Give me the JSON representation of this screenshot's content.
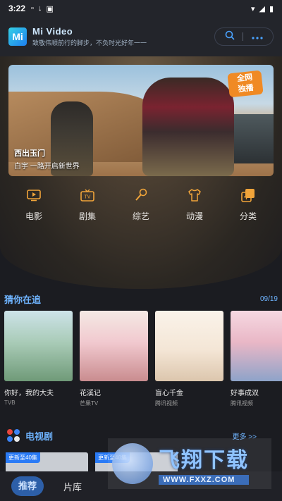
{
  "status_bar": {
    "time": "3:22"
  },
  "header": {
    "logo_text": "Mi",
    "app_name": "Mi Video",
    "slogan": "致敬伟顺前行的脚步，不负时光好年一一"
  },
  "banner": {
    "badge": "全网\n独播",
    "title": "西出玉门",
    "subtitle": "白宇&nbsp;一路开启新世界"
  },
  "categories": [
    {
      "label": "电影",
      "icon": "tv-icon"
    },
    {
      "label": "剧集",
      "icon": "tv-set-icon"
    },
    {
      "label": "综艺",
      "icon": "microphone-icon"
    },
    {
      "label": "动漫",
      "icon": "tshirt-icon"
    },
    {
      "label": "分类",
      "icon": "layers-icon"
    }
  ],
  "section1": {
    "title": "猜你在追",
    "date": "09/19"
  },
  "posters": [
    {
      "title": "你好，我的大夫",
      "source": "TVB",
      "color_a": "#a9cbb7",
      "color_b": "#d8dcc8"
    },
    {
      "title": "花溪记",
      "source": "芒果TV",
      "color_a": "#f1c9cf",
      "color_b": "#e7dbd3"
    },
    {
      "title": "盲心千金",
      "source": "腾讯视频",
      "color_a": "#f4e6d6",
      "color_b": "#efe2cf"
    },
    {
      "title": "好事成双",
      "source": "腾讯视频",
      "color_a": "#e9b7c6",
      "color_b": "#b9c6de"
    }
  ],
  "section2": {
    "title": "电视剧",
    "more": "更多 >>"
  },
  "row2_tags": [
    "更新至40集",
    "更新至40集"
  ],
  "tabs": {
    "recommend": "推荐",
    "library": "片库"
  },
  "watermark": {
    "title": "飞翔下载",
    "url": "WWW.FXXZ.COM"
  }
}
